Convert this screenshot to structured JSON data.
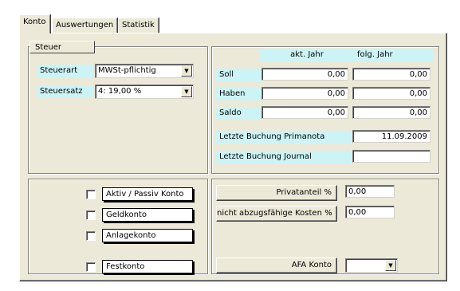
{
  "tabs": [
    {
      "label": "Konto",
      "active": true
    },
    {
      "label": "Auswertungen",
      "active": false
    },
    {
      "label": "Statistik",
      "active": false
    }
  ],
  "steuer": {
    "tab_label": "Steuer",
    "steuerart_label": "Steuerart",
    "steuerart_value": "MWSt-pflichtig",
    "steuersatz_label": "Steuersatz",
    "steuersatz_value": "4: 19,00 %"
  },
  "summary": {
    "col_current": "akt. Jahr",
    "col_next": "folg. Jahr",
    "rows": [
      {
        "label": "Soll",
        "current": "0,00",
        "next": "0,00"
      },
      {
        "label": "Haben",
        "current": "0,00",
        "next": "0,00"
      },
      {
        "label": "Saldo",
        "current": "0,00",
        "next": "0,00"
      }
    ],
    "last_primanota_label": "Letzte Buchung Primanota",
    "last_primanota_value": "11.09.2009",
    "last_journal_label": "Letzte Buchung Journal",
    "last_journal_value": ""
  },
  "checkboxes": [
    {
      "label": "Aktiv / Passiv Konto",
      "checked": false
    },
    {
      "label": "Geldkonto",
      "checked": false
    },
    {
      "label": "Anlagekonto",
      "checked": false
    },
    {
      "label": "Festkonto",
      "checked": false
    }
  ],
  "costs": {
    "privatanteil_label": "Privatanteil %",
    "privatanteil_value": "0,00",
    "nicht_abzugsfaehig_label": "nicht abzugsfähige Kosten %",
    "nicht_abzugsfaehig_value": "0,00",
    "afa_label": "AFA Konto",
    "afa_value": ""
  },
  "icons": {
    "dropdown": "chevron-down-icon"
  },
  "colors": {
    "label_bg": "#ccf4f6",
    "panel_bg": "#ece9d8"
  }
}
